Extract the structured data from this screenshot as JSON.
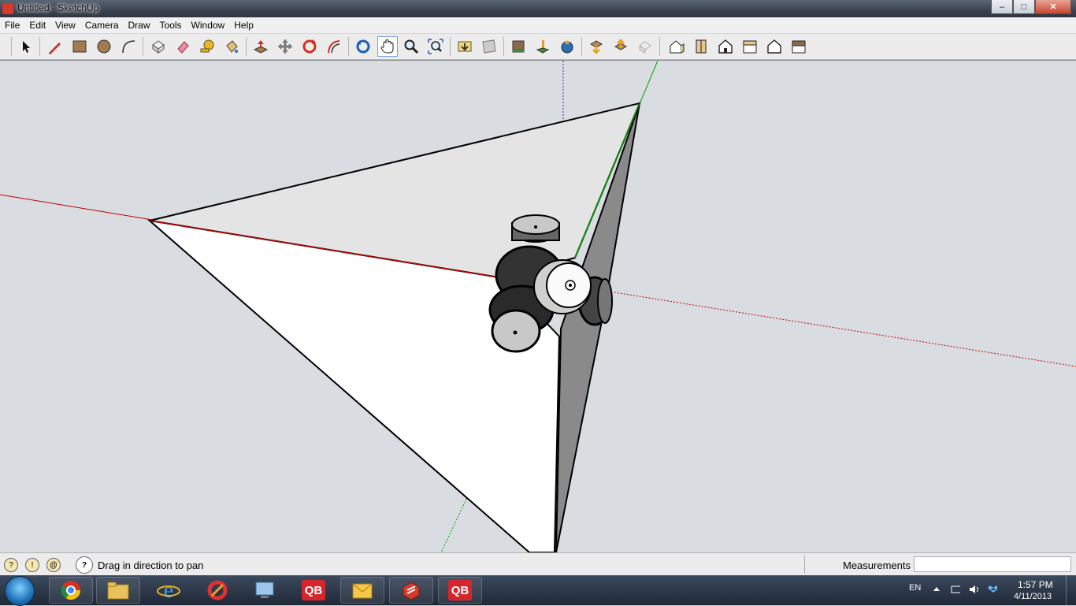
{
  "window": {
    "title": "Untitled - SketchUp"
  },
  "window_controls": {
    "minimize": "–",
    "maximize": "□",
    "close": "✕"
  },
  "menu": [
    "File",
    "Edit",
    "View",
    "Camera",
    "Draw",
    "Tools",
    "Window",
    "Help"
  ],
  "toolbar": {
    "tools": [
      {
        "name": "select-tool",
        "icon": "arrow-icon"
      },
      {
        "name": "line-tool",
        "icon": "pencil-icon"
      },
      {
        "name": "rectangle-tool",
        "icon": "rectangle-icon"
      },
      {
        "name": "circle-tool",
        "icon": "circle-icon"
      },
      {
        "name": "arc-tool",
        "icon": "arc-icon"
      },
      {
        "name": "make-component-tool",
        "icon": "component-icon"
      },
      {
        "name": "eraser-tool",
        "icon": "eraser-icon"
      },
      {
        "name": "tape-measure-tool",
        "icon": "tape-measure-icon"
      },
      {
        "name": "paint-bucket-tool",
        "icon": "paint-bucket-icon"
      },
      {
        "name": "push-pull-tool",
        "icon": "push-pull-icon"
      },
      {
        "name": "move-tool",
        "icon": "move-icon"
      },
      {
        "name": "rotate-tool",
        "icon": "rotate-icon"
      },
      {
        "name": "offset-tool",
        "icon": "offset-icon"
      },
      {
        "name": "orbit-tool",
        "icon": "orbit-icon"
      },
      {
        "name": "pan-tool",
        "icon": "hand-icon"
      },
      {
        "name": "zoom-tool",
        "icon": "magnifier-icon"
      },
      {
        "name": "zoom-extents-tool",
        "icon": "zoom-extents-icon"
      },
      {
        "name": "previous-view-tool",
        "icon": "previous-view-icon"
      },
      {
        "name": "next-view-tool",
        "icon": "next-view-icon"
      },
      {
        "name": "google-earth-tool",
        "icon": "earth-icon"
      },
      {
        "name": "place-model-tool",
        "icon": "place-model-icon"
      },
      {
        "name": "share-model-tool",
        "icon": "share-model-icon"
      },
      {
        "name": "get-models-tool",
        "icon": "get-models-icon"
      },
      {
        "name": "share-component-tool",
        "icon": "share-component-icon"
      },
      {
        "name": "extension-warehouse-tool",
        "icon": "warehouse-icon"
      },
      {
        "name": "iso-view",
        "icon": "iso-house-icon"
      },
      {
        "name": "top-view",
        "icon": "top-house-icon"
      },
      {
        "name": "front-view",
        "icon": "front-house-icon"
      },
      {
        "name": "right-view",
        "icon": "right-house-icon"
      },
      {
        "name": "back-view",
        "icon": "back-house-icon"
      },
      {
        "name": "left-view",
        "icon": "left-house-icon"
      }
    ]
  },
  "status": {
    "hint": "Drag in direction to pan",
    "measurements_label": "Measurements",
    "measurements_value": ""
  },
  "taskbar": {
    "apps": [
      {
        "name": "chrome",
        "icon": "chrome-icon"
      },
      {
        "name": "explorer",
        "icon": "folder-icon"
      },
      {
        "name": "internet-explorer",
        "icon": "ie-icon"
      },
      {
        "name": "ccleaner",
        "icon": "ccleaner-icon"
      },
      {
        "name": "remote-desktop",
        "icon": "remote-icon"
      },
      {
        "name": "quickbooks-1",
        "icon": "qb-icon",
        "label": "QB"
      },
      {
        "name": "outlook",
        "icon": "outlook-icon"
      },
      {
        "name": "sketchup",
        "icon": "sketchup-icon"
      },
      {
        "name": "quickbooks-2",
        "icon": "qb-icon",
        "label": "QB"
      }
    ],
    "language": "EN",
    "time": "1:57 PM",
    "date": "4/11/2013"
  },
  "colors": {
    "viewport_bg": "#d9dde1",
    "red_axis": "#c00000",
    "green_axis": "#00a000",
    "blue_axis": "#2030c0",
    "taskbar": "#2a3445"
  }
}
